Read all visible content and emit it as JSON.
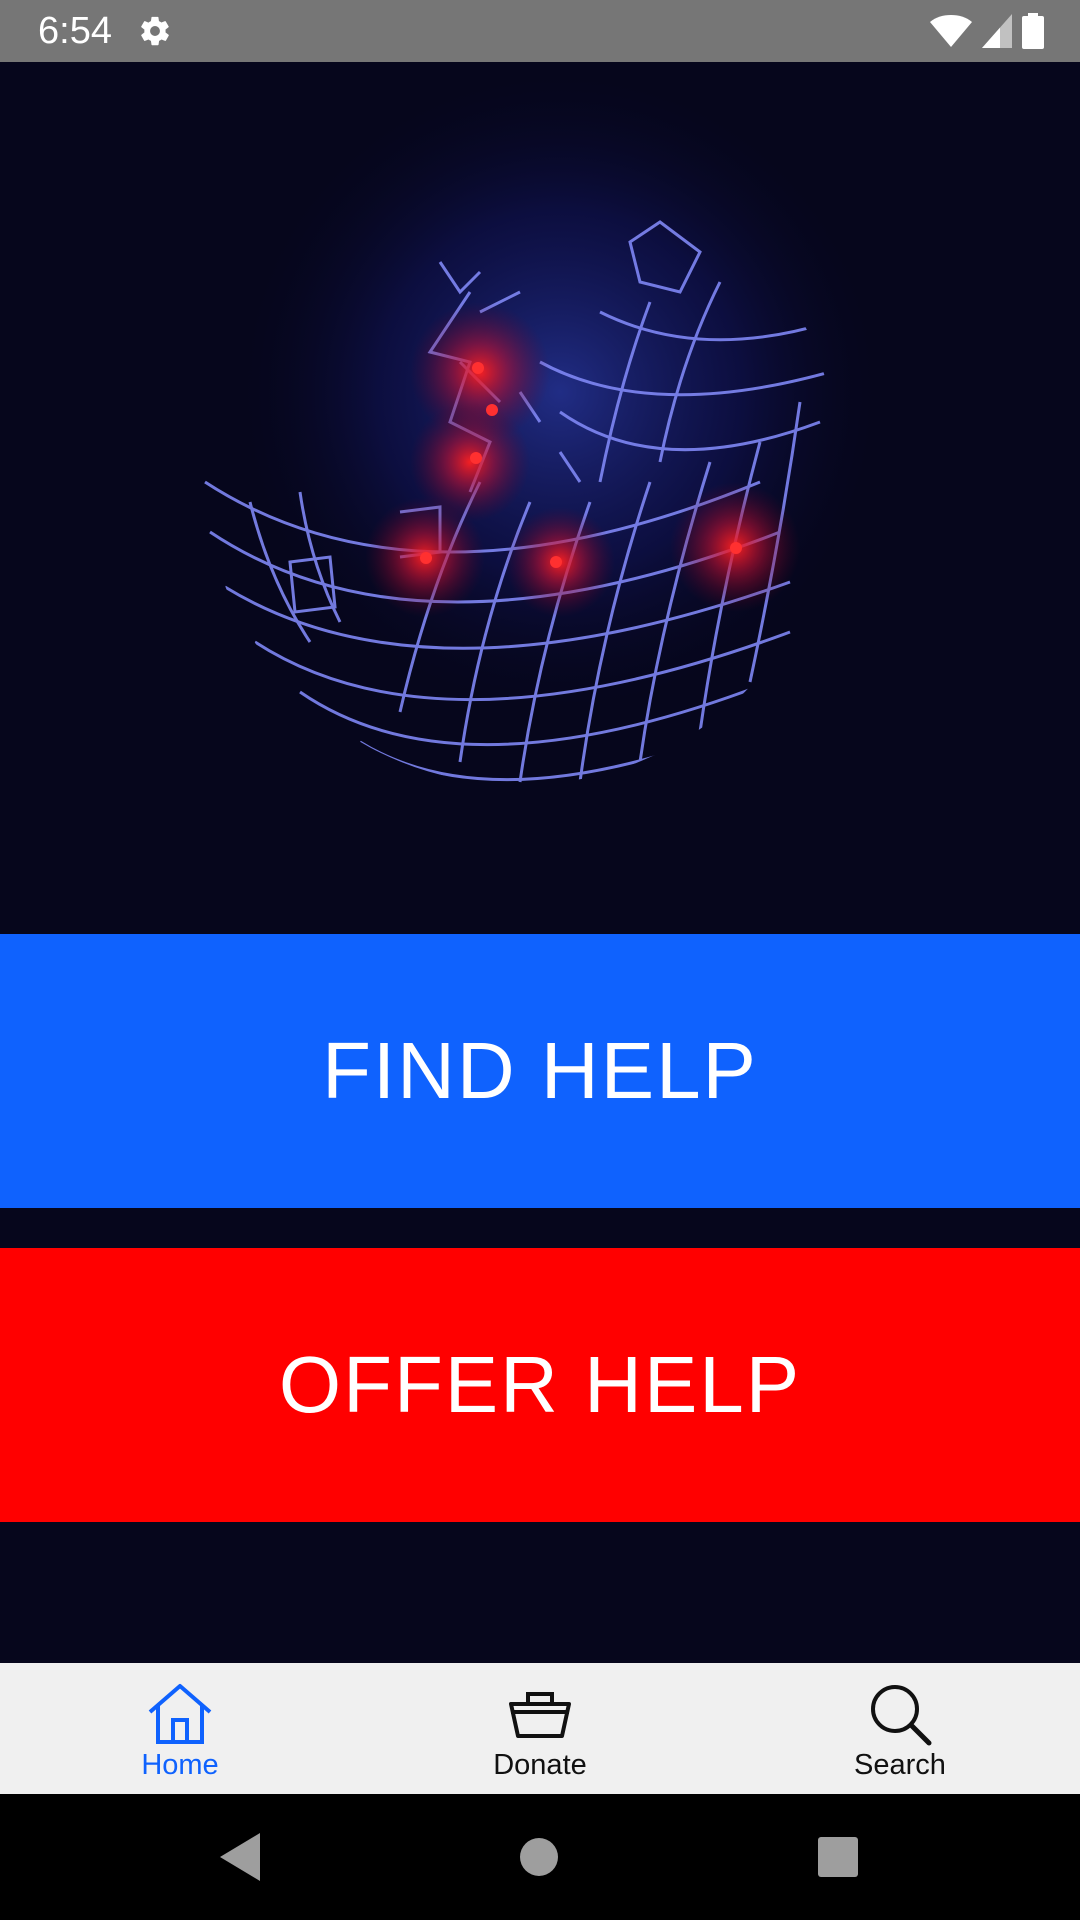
{
  "status_bar": {
    "time": "6:54",
    "icons": [
      "settings-gear-icon",
      "wifi-icon",
      "signal-icon",
      "battery-icon"
    ]
  },
  "hero": {
    "image": "globe-network-icon"
  },
  "actions": {
    "find_help": "FIND HELP",
    "offer_help": "OFFER HELP"
  },
  "bottom_nav": {
    "items": [
      {
        "label": "Home",
        "icon": "home-icon",
        "active": true
      },
      {
        "label": "Donate",
        "icon": "basket-icon",
        "active": false
      },
      {
        "label": "Search",
        "icon": "search-icon",
        "active": false
      }
    ]
  },
  "system_nav": {
    "buttons": [
      "back-icon",
      "home-circle-icon",
      "recents-icon"
    ]
  },
  "colors": {
    "background": "#06061c",
    "status_bar": "#767676",
    "find_help": "#0f62fe",
    "offer_help": "#ff0000",
    "nav_active": "#0f62fe",
    "nav_background": "#f0f0f0"
  }
}
